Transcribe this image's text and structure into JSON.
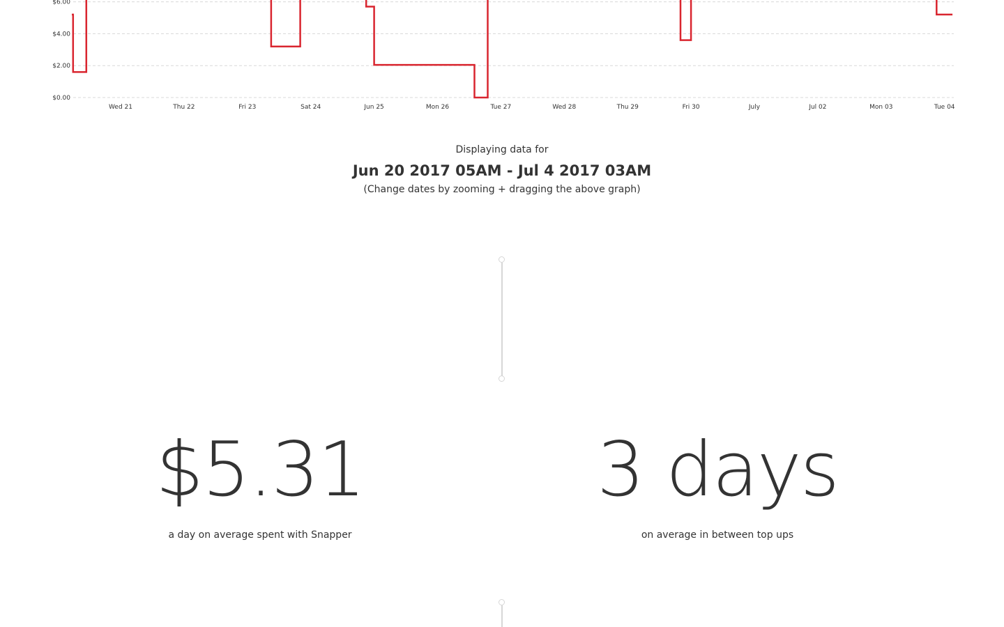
{
  "chart_data": {
    "type": "line",
    "step": true,
    "color": "#d9252f",
    "y_ticks": [
      "$0.00",
      "$2.00",
      "$4.00",
      "$6.00"
    ],
    "x_tick_labels": [
      "Wed 21",
      "Thu 22",
      "Fri 23",
      "Sat 24",
      "Jun 25",
      "Mon 26",
      "Tue 27",
      "Wed 28",
      "Thu 29",
      "Fri 30",
      "July",
      "Jul 02",
      "Mon 03",
      "Tue 04"
    ],
    "ylim_visible": [
      0,
      6
    ],
    "grid": "horizontal dashed",
    "series": [
      {
        "points": [
          [
            "2017-06-20 05:00",
            5.2
          ],
          [
            "2017-06-20 06:00",
            1.6
          ],
          [
            "2017-06-20 11:00",
            7.0
          ],
          [
            "2017-06-23 09:00",
            3.2
          ],
          [
            "2017-06-23 20:00",
            7.0
          ],
          [
            "2017-06-24 21:00",
            5.7
          ],
          [
            "2017-06-25 00:00",
            2.05
          ],
          [
            "2017-06-26 14:00",
            0.0
          ],
          [
            "2017-06-26 19:00",
            7.0
          ],
          [
            "2017-06-29 20:00",
            3.6
          ],
          [
            "2017-06-30 00:00",
            7.0
          ],
          [
            "2017-07-03 21:00",
            5.2
          ],
          [
            "2017-07-04 03:00",
            5.2
          ]
        ]
      }
    ]
  },
  "range": {
    "intro": "Displaying data for",
    "dates": "Jun 20 2017 05AM - Jul 4 2017 03AM",
    "hint": "(Change dates by zooming + dragging the above graph)"
  },
  "stats": {
    "daily_spend": {
      "value": "$5.31",
      "caption": "a day on average spent with Snapper"
    },
    "top_up_interval": {
      "value": "3 days",
      "caption": "on average in between top ups"
    }
  }
}
